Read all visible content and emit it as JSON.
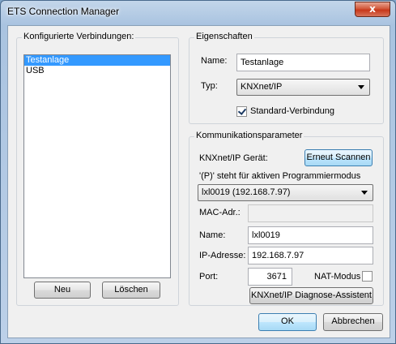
{
  "window": {
    "title": "ETS Connection Manager",
    "close_glyph": "x"
  },
  "connections": {
    "group_title": "Konfigurierte Verbindungen:",
    "items": [
      "Testanlage",
      "USB"
    ],
    "selected_index": 0,
    "new_button": "Neu",
    "delete_button": "Löschen"
  },
  "properties": {
    "group_title": "Eigenschaften",
    "name_label": "Name:",
    "name_value": "Testanlage",
    "type_label": "Typ:",
    "type_value": "KNXnet/IP",
    "default_label": "Standard-Verbindung",
    "default_checked": true
  },
  "comm": {
    "group_title": "Kommunikationsparameter",
    "device_label": "KNXnet/IP Gerät:",
    "rescan_button": "Erneut Scannen",
    "hint": "'(P)' steht für aktiven Programmiermodus",
    "device_value": "lxl0019 (192.168.7.97)",
    "mac_label": "MAC-Adr.:",
    "mac_value": "",
    "name_label": "Name:",
    "name_value": "lxl0019",
    "ip_label": "IP-Adresse:",
    "ip_value": "192.168.7.97",
    "port_label": "Port:",
    "port_value": "3671",
    "nat_label": "NAT-Modus",
    "nat_checked": false,
    "diag_button": "KNXnet/IP Diagnose-Assistent"
  },
  "footer": {
    "ok_button": "OK",
    "cancel_button": "Abbrechen"
  }
}
